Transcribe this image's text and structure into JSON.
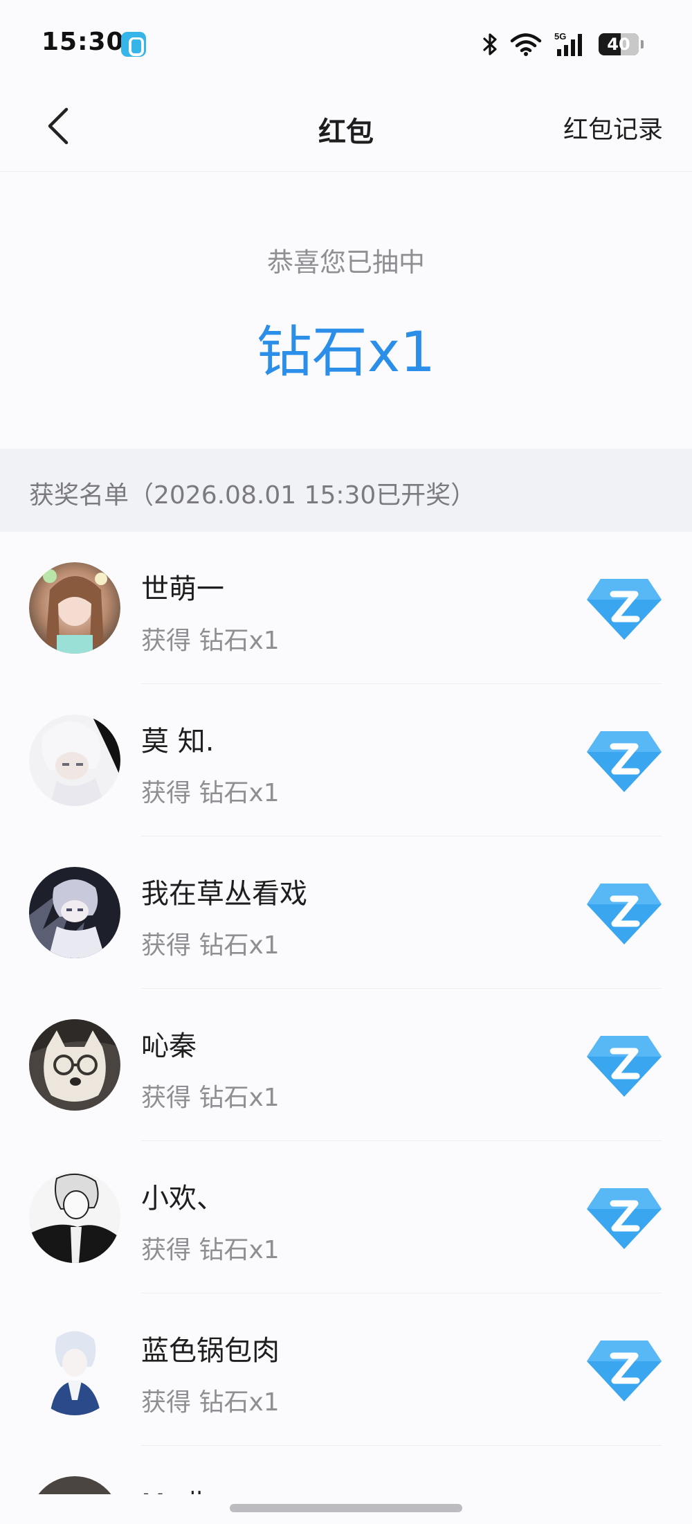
{
  "status_bar": {
    "time": "15:30",
    "battery_level": "40",
    "signal_label": "5G",
    "icons": [
      "app-notification-icon",
      "bluetooth-icon",
      "wifi-icon",
      "signal-icon",
      "battery-icon"
    ]
  },
  "nav": {
    "back_icon": "chevron-left-icon",
    "title": "红包",
    "records_label": "红包记录"
  },
  "result": {
    "subtitle": "恭喜您已抽中",
    "prize": "钻石x1",
    "prize_color": "#2b8ee8"
  },
  "winners": {
    "header": "获奖名单（2026.08.01 15:30已开奖）",
    "items": [
      {
        "name": "世萌一",
        "prize": "获得 钻石x1",
        "icon": "diamond-icon"
      },
      {
        "name": "莫 知.",
        "prize": "获得 钻石x1",
        "icon": "diamond-icon"
      },
      {
        "name": "我在草丛看戏",
        "prize": "获得 钻石x1",
        "icon": "diamond-icon"
      },
      {
        "name": "吣秦",
        "prize": "获得 钻石x1",
        "icon": "diamond-icon"
      },
      {
        "name": "小欢、",
        "prize": "获得 钻石x1",
        "icon": "diamond-icon"
      },
      {
        "name": "蓝色锅包肉",
        "prize": "获得 钻石x1",
        "icon": "diamond-icon"
      }
    ],
    "partial_item": {
      "name": "M. 北"
    }
  },
  "colors": {
    "accent": "#2b8ee8",
    "diamond": "#3aa6f0",
    "muted_text": "#8e8e93",
    "header_bg": "#f1f2f6"
  }
}
